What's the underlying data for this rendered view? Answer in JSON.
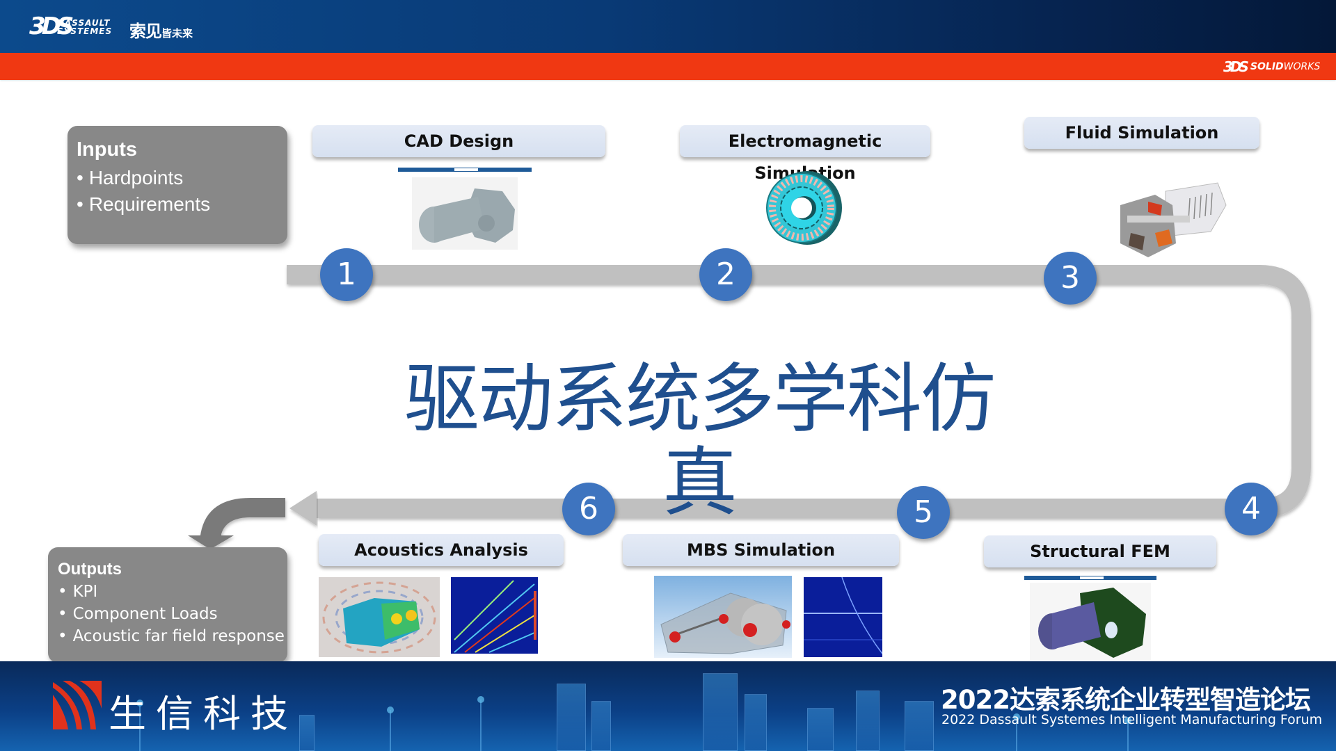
{
  "header": {
    "brand_mark": "3DS",
    "brand_line1": "DASSAULT",
    "brand_line2": "SYSTEMES",
    "slogan_main": "索见",
    "slogan_sub": "皆未来",
    "product_mark": "3DS",
    "product_bold": "SOLID",
    "product_light": "WORKS",
    "colors": {
      "header_blue": "#0c4a8c",
      "accent_orange": "#f03812"
    }
  },
  "title": "驱动系统多学科仿真",
  "inputs": {
    "title": "Inputs",
    "items": [
      "Hardpoints",
      "Requirements"
    ]
  },
  "outputs": {
    "title": "Outputs",
    "items": [
      "KPI",
      "Component Loads",
      "Acoustic far field response"
    ]
  },
  "steps": [
    {
      "number": "1",
      "label": "CAD Design",
      "image": "cad-gearbox-motor-image"
    },
    {
      "number": "2",
      "label": "Electromagnetic Simulation",
      "image": "stator-ring-image"
    },
    {
      "number": "3",
      "label": "Fluid Simulation",
      "image": "motor-cutaway-image"
    },
    {
      "number": "4",
      "label": "Structural FEM",
      "image": "fem-gearbox-image"
    },
    {
      "number": "5",
      "label": "MBS Simulation",
      "image": "mbs-gearbox-image"
    },
    {
      "number": "6",
      "label": "Acoustics Analysis",
      "image": "acoustic-field-image"
    }
  ],
  "step_color": "#3e74bf",
  "footer": {
    "company": "生信科技",
    "forum_cn": "2022达索系统企业转型智造论坛",
    "forum_en": "2022 Dassault Systemes Intelligent Manufacturing Forum"
  }
}
